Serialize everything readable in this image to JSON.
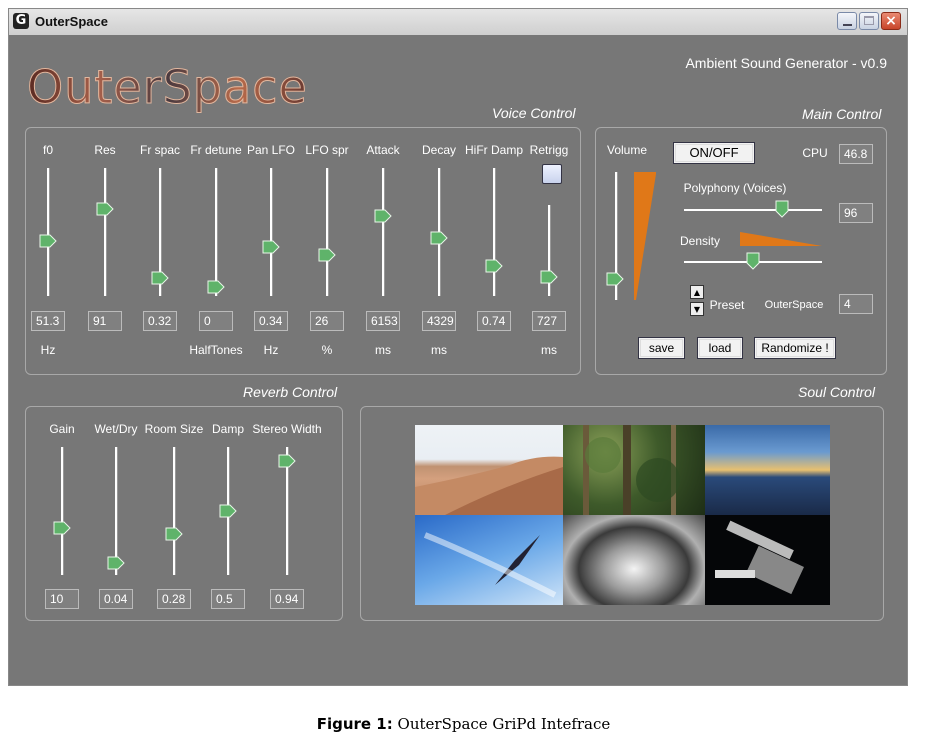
{
  "window": {
    "title": "OuterSpace",
    "app_icon": "G",
    "close_glyph": "×"
  },
  "header": {
    "logo": "OuterSpace",
    "subtitle": "Ambient Sound Generator - v0.9"
  },
  "voice": {
    "title": "Voice Control",
    "sliders": [
      {
        "label": "f0",
        "value": "51.3",
        "unit": "Hz",
        "level": 0.42
      },
      {
        "label": "Res",
        "value": "91",
        "unit": "",
        "level": 0.7
      },
      {
        "label": "Fr spac",
        "value": "0.32",
        "unit": "",
        "level": 0.1
      },
      {
        "label": "Fr detune",
        "value": "0",
        "unit": "HalfTones",
        "level": 0.02
      },
      {
        "label": "Pan LFO",
        "value": "0.34",
        "unit": "Hz",
        "level": 0.37
      },
      {
        "label": "LFO spr",
        "value": "26",
        "unit": "%",
        "level": 0.3
      },
      {
        "label": "Attack",
        "value": "6153",
        "unit": "ms",
        "level": 0.64
      },
      {
        "label": "Decay",
        "value": "4329",
        "unit": "ms",
        "level": 0.45
      },
      {
        "label": "HiFr Damp",
        "value": "0.74",
        "unit": "",
        "level": 0.2
      },
      {
        "label": "Retrigg",
        "value": "727",
        "unit": "ms",
        "level": 0.15
      }
    ]
  },
  "main": {
    "title": "Main Control",
    "volume_label": "Volume",
    "volume_level": 0.12,
    "onoff_label": "ON/OFF",
    "cpu_label": "CPU",
    "cpu_value": "46.8",
    "polyphony_label": "Polyphony (Voices)",
    "polyphony_value": "96",
    "polyphony_level": 0.73,
    "density_label": "Density",
    "density_level": 0.5,
    "preset_label": "Preset",
    "preset_name": "OuterSpace",
    "preset_number": "4",
    "spinner_up": "▲",
    "spinner_down": "▼",
    "save_label": "save",
    "load_label": "load",
    "randomize_label": "Randomize !"
  },
  "reverb": {
    "title": "Reverb Control",
    "sliders": [
      {
        "label": "Gain",
        "value": "10",
        "level": 0.35
      },
      {
        "label": "Wet/Dry",
        "value": "0.04",
        "level": 0.04
      },
      {
        "label": "Room Size",
        "value": "0.28",
        "level": 0.3
      },
      {
        "label": "Damp",
        "value": "0.5",
        "level": 0.5
      },
      {
        "label": "Stereo Width",
        "value": "0.94",
        "level": 0.94
      }
    ]
  },
  "soul": {
    "title": "Soul Control",
    "photos": [
      "desert-photo",
      "jungle-photo",
      "sunset-sea-photo",
      "sky-bird-photo",
      "water-drop-photo",
      "space-station-photo"
    ]
  },
  "caption": {
    "label": "Figure 1:",
    "text": "OuterSpace GriPd Intefrace"
  },
  "colors": {
    "background": "#777777",
    "accent": "#e07818",
    "thumb": "#5fb36a"
  }
}
